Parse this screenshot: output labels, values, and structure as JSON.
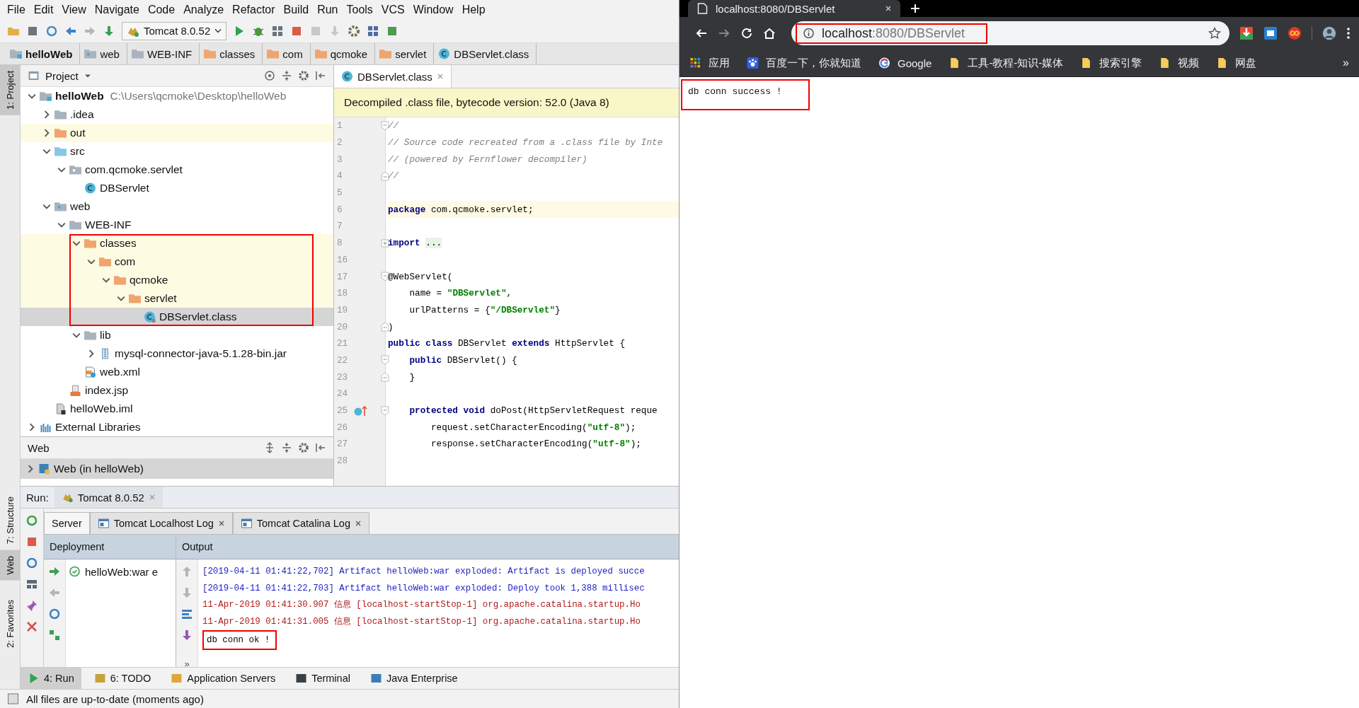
{
  "menu": [
    "File",
    "Edit",
    "View",
    "Navigate",
    "Code",
    "Analyze",
    "Refactor",
    "Build",
    "Run",
    "Tools",
    "VCS",
    "Window",
    "Help"
  ],
  "run_config": "Tomcat 8.0.52",
  "breadcrumbs": [
    {
      "label": "helloWeb",
      "kind": "module"
    },
    {
      "label": "web",
      "kind": "web"
    },
    {
      "label": "WEB-INF",
      "kind": "folder"
    },
    {
      "label": "classes",
      "kind": "excluded"
    },
    {
      "label": "com",
      "kind": "excluded"
    },
    {
      "label": "qcmoke",
      "kind": "excluded"
    },
    {
      "label": "servlet",
      "kind": "excluded"
    },
    {
      "label": "DBServlet.class",
      "kind": "class"
    }
  ],
  "side_tabs": [
    {
      "label": "1: Project",
      "selected": true
    },
    {
      "label": "7: Structure",
      "selected": false
    },
    {
      "label": "Web",
      "selected": true
    },
    {
      "label": "2: Favorites",
      "selected": false
    }
  ],
  "project": {
    "title": "Project",
    "tree": [
      {
        "label": "helloWeb",
        "hint": "C:\\Users\\qcmoke\\Desktop\\helloWeb",
        "kind": "module",
        "expanded": true,
        "selected": false,
        "highlighted": false,
        "children": [
          {
            "label": ".idea",
            "kind": "folder",
            "expanded": false,
            "selected": false,
            "highlighted": false
          },
          {
            "label": "out",
            "kind": "excluded",
            "expanded": false,
            "selected": false,
            "highlighted": true
          },
          {
            "label": "src",
            "kind": "source",
            "expanded": true,
            "selected": false,
            "highlighted": false,
            "children": [
              {
                "label": "com.qcmoke.servlet",
                "kind": "package",
                "expanded": true,
                "selected": false,
                "highlighted": false,
                "children": [
                  {
                    "label": "DBServlet",
                    "kind": "class",
                    "selected": false,
                    "highlighted": false
                  }
                ]
              }
            ]
          },
          {
            "label": "web",
            "kind": "web",
            "expanded": true,
            "selected": false,
            "highlighted": false,
            "children": [
              {
                "label": "WEB-INF",
                "kind": "folder",
                "expanded": true,
                "selected": false,
                "highlighted": false,
                "children": [
                  {
                    "label": "classes",
                    "kind": "excluded",
                    "expanded": true,
                    "selected": false,
                    "highlighted": true,
                    "annotated": true,
                    "children": [
                      {
                        "label": "com",
                        "kind": "excluded",
                        "expanded": true,
                        "selected": false,
                        "highlighted": true,
                        "children": [
                          {
                            "label": "qcmoke",
                            "kind": "excluded",
                            "expanded": true,
                            "selected": false,
                            "highlighted": true,
                            "children": [
                              {
                                "label": "servlet",
                                "kind": "excluded",
                                "expanded": true,
                                "selected": false,
                                "highlighted": true,
                                "children": [
                                  {
                                    "label": "DBServlet.class",
                                    "kind": "classfile",
                                    "selected": true,
                                    "highlighted": false
                                  }
                                ]
                              }
                            ]
                          }
                        ]
                      }
                    ]
                  },
                  {
                    "label": "lib",
                    "kind": "folder",
                    "expanded": true,
                    "selected": false,
                    "highlighted": false,
                    "children": [
                      {
                        "label": "mysql-connector-java-5.1.28-bin.jar",
                        "kind": "jar",
                        "expanded": false,
                        "selected": false,
                        "highlighted": false
                      }
                    ]
                  },
                  {
                    "label": "web.xml",
                    "kind": "xml",
                    "selected": false,
                    "highlighted": false
                  }
                ]
              },
              {
                "label": "index.jsp",
                "kind": "jsp",
                "selected": false,
                "highlighted": false
              }
            ]
          },
          {
            "label": "helloWeb.iml",
            "kind": "iml",
            "selected": false,
            "highlighted": false
          }
        ]
      },
      {
        "label": "External Libraries",
        "kind": "libraries",
        "expanded": false,
        "selected": false,
        "highlighted": false
      }
    ]
  },
  "editor": {
    "tab": "DBServlet.class",
    "banner": "Decompiled .class file, bytecode version: 52.0 (Java 8)",
    "lines": [
      {
        "num": "1",
        "fold_start": true,
        "tokens": [
          {
            "t": "//",
            "kind": "comment"
          }
        ]
      },
      {
        "num": "2",
        "tokens": [
          {
            "t": "// Source code recreated from a .class file by Inte",
            "kind": "comment"
          }
        ]
      },
      {
        "num": "3",
        "tokens": [
          {
            "t": "// (powered by Fernflower decompiler)",
            "kind": "comment"
          }
        ]
      },
      {
        "num": "4",
        "fold_end": true,
        "tokens": [
          {
            "t": "//",
            "kind": "comment"
          }
        ]
      },
      {
        "num": "5"
      },
      {
        "num": "6",
        "current": true,
        "tokens": [
          {
            "t": "package",
            "kind": "kw"
          },
          {
            "t": " com.qcmoke.servlet;",
            "kind": "plain"
          }
        ]
      },
      {
        "num": "7"
      },
      {
        "num": "8",
        "folded": true,
        "tokens": [
          {
            "t": "import",
            "kind": "kw"
          },
          {
            "t": "...",
            "kind": "folded"
          }
        ]
      },
      {
        "num": "16"
      },
      {
        "num": "17",
        "fold_start": true,
        "tokens": [
          {
            "t": "@WebServlet(",
            "kind": "plain"
          }
        ]
      },
      {
        "num": "18",
        "tokens": [
          {
            "t": "    name = ",
            "kind": "plain"
          },
          {
            "t": "\"DBServlet\"",
            "kind": "str"
          },
          {
            "t": ",",
            "kind": "plain"
          }
        ]
      },
      {
        "num": "19",
        "tokens": [
          {
            "t": "    urlPatterns = {",
            "kind": "plain"
          },
          {
            "t": "\"/DBServlet\"",
            "kind": "str"
          },
          {
            "t": "}",
            "kind": "plain"
          }
        ]
      },
      {
        "num": "20",
        "fold_end": true,
        "tokens": [
          {
            "t": ")",
            "kind": "plain"
          }
        ]
      },
      {
        "num": "21",
        "tokens": [
          {
            "t": "public class",
            "kind": "kw"
          },
          {
            "t": " DBServlet ",
            "kind": "plain"
          },
          {
            "t": "extends",
            "kind": "kw"
          },
          {
            "t": " HttpServlet {",
            "kind": "plain"
          }
        ]
      },
      {
        "num": "22",
        "fold_start": true,
        "tokens": [
          {
            "t": "    public",
            "kind": "kw"
          },
          {
            "t": " DBServlet() {",
            "kind": "plain"
          }
        ]
      },
      {
        "num": "23",
        "fold_end": true,
        "tokens": [
          {
            "t": "    }",
            "kind": "plain"
          }
        ]
      },
      {
        "num": "24"
      },
      {
        "num": "25",
        "fold_start": true,
        "overrides": true,
        "tokens": [
          {
            "t": "    protected void",
            "kind": "kw"
          },
          {
            "t": " doPost(HttpServletRequest reque",
            "kind": "plain"
          }
        ]
      },
      {
        "num": "26",
        "tokens": [
          {
            "t": "        request.setCharacterEncoding(",
            "kind": "plain"
          },
          {
            "t": "\"utf-8\"",
            "kind": "str"
          },
          {
            "t": ");",
            "kind": "plain"
          }
        ]
      },
      {
        "num": "27",
        "tokens": [
          {
            "t": "        response.setCharacterEncoding(",
            "kind": "plain"
          },
          {
            "t": "\"utf-8\"",
            "kind": "str"
          },
          {
            "t": ");",
            "kind": "plain"
          }
        ]
      },
      {
        "num": "28"
      }
    ]
  },
  "web_pane": {
    "title": "Web",
    "items": [
      {
        "label": "Web (in helloWeb)",
        "expanded": false,
        "selected": true
      }
    ]
  },
  "run": {
    "label": "Run:",
    "tab": "Tomcat 8.0.52",
    "subtabs": [
      {
        "label": "Server",
        "selected": true,
        "closable": false
      },
      {
        "label": "Tomcat Localhost Log",
        "selected": false,
        "closable": true
      },
      {
        "label": "Tomcat Catalina Log",
        "selected": false,
        "closable": true
      }
    ],
    "deployment": {
      "header": "Deployment",
      "items": [
        {
          "label": "helloWeb:war e"
        }
      ]
    },
    "output": {
      "header": "Output",
      "more": "»",
      "lines": [
        {
          "text": "[2019-04-11 01:41:22,702] Artifact helloWeb:war exploded: Artifact is deployed succe",
          "kind": "info",
          "annotated": false
        },
        {
          "text": "[2019-04-11 01:41:22,703] Artifact helloWeb:war exploded: Deploy took 1,388 millisec",
          "kind": "info",
          "annotated": false
        },
        {
          "text": "11-Apr-2019 01:41:30.907 信息 [localhost-startStop-1] org.apache.catalina.startup.Ho",
          "kind": "log",
          "annotated": false
        },
        {
          "text": "11-Apr-2019 01:41:31.005 信息 [localhost-startStop-1] org.apache.catalina.startup.Ho",
          "kind": "log",
          "annotated": false
        },
        {
          "text": "db conn ok !",
          "kind": "plain",
          "annotated": true
        }
      ]
    }
  },
  "tool_tabs": [
    {
      "label": "4: Run",
      "selected": true
    },
    {
      "label": "6: TODO",
      "selected": false
    },
    {
      "label": "Application Servers",
      "selected": false
    },
    {
      "label": "Terminal",
      "selected": false
    },
    {
      "label": "Java Enterprise",
      "selected": false
    }
  ],
  "status": "All files are up-to-date (moments ago)",
  "browser": {
    "tab_title": "localhost:8080/DBServlet",
    "url_host": "localhost",
    "url_rest": ":8080/DBServlet",
    "url_annotated": true,
    "bookmarks": [
      {
        "label": "应用",
        "kind": "apps"
      },
      {
        "label": "百度一下，你就知道",
        "kind": "paw"
      },
      {
        "label": "Google",
        "kind": "google"
      },
      {
        "label": "工具-教程-知识-媒体",
        "kind": "folder"
      },
      {
        "label": "搜索引擎",
        "kind": "folder"
      },
      {
        "label": "视频",
        "kind": "folder"
      },
      {
        "label": "网盘",
        "kind": "folder"
      }
    ],
    "more": "»",
    "body": "db conn success !",
    "body_annotated": true
  }
}
